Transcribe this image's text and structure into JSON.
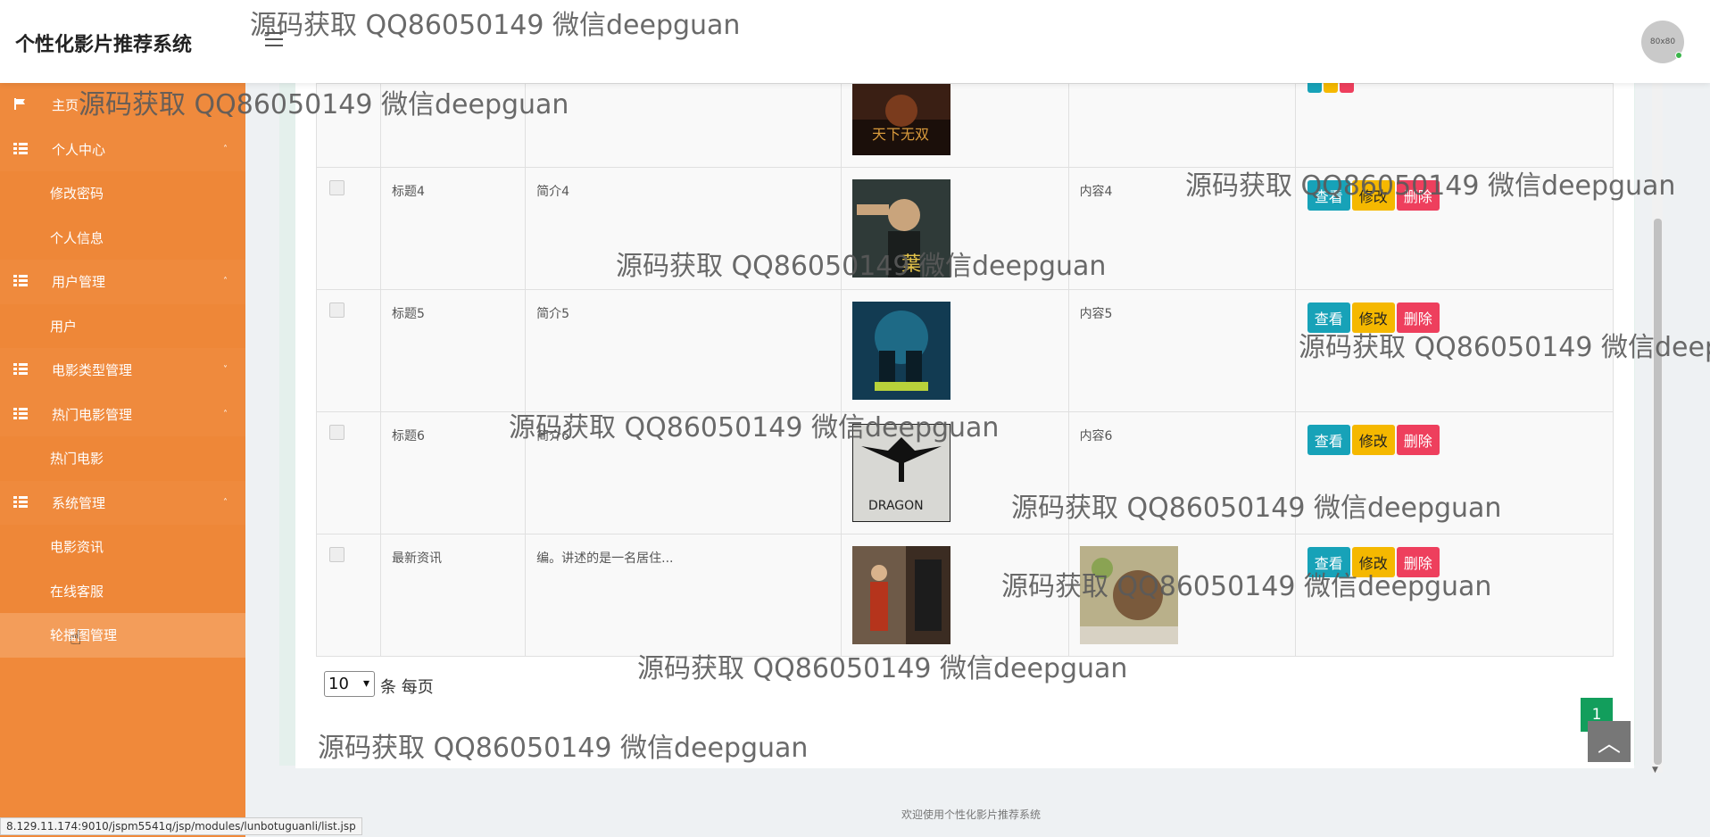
{
  "app": {
    "title": "个性化影片推荐系统",
    "avatar_text": "80x80"
  },
  "sidebar": {
    "items": [
      {
        "label": "主页",
        "type": "group",
        "icon": "flag-icon",
        "caret": ""
      },
      {
        "label": "个人中心",
        "type": "group",
        "icon": "grid-icon",
        "caret": "˄"
      },
      {
        "label": "修改密码",
        "type": "sub"
      },
      {
        "label": "个人信息",
        "type": "sub"
      },
      {
        "label": "用户管理",
        "type": "group",
        "icon": "grid-icon",
        "caret": "˄"
      },
      {
        "label": "用户",
        "type": "sub"
      },
      {
        "label": "电影类型管理",
        "type": "group",
        "icon": "grid-icon",
        "caret": "˅"
      },
      {
        "label": "热门电影管理",
        "type": "group",
        "icon": "grid-icon",
        "caret": "˄"
      },
      {
        "label": "热门电影",
        "type": "sub"
      },
      {
        "label": "系统管理",
        "type": "group",
        "icon": "grid-icon",
        "caret": "˄"
      },
      {
        "label": "电影资讯",
        "type": "sub"
      },
      {
        "label": "在线客服",
        "type": "sub"
      },
      {
        "label": "轮播图管理",
        "type": "sub",
        "hover": true
      }
    ]
  },
  "table": {
    "rows": [
      {
        "title": "",
        "intro": "",
        "content": "",
        "poster": "poster-kungfu-dark",
        "image2": ""
      },
      {
        "title": "标题4",
        "intro": "简介4",
        "content": "内容4",
        "poster": "poster-ipman"
      },
      {
        "title": "标题5",
        "intro": "简介5",
        "content": "内容5",
        "poster": "poster-blue-action"
      },
      {
        "title": "标题6",
        "intro": "简介6",
        "content": "内容6",
        "poster": "poster-dragon"
      },
      {
        "title": "最新资讯",
        "intro": "编。讲述的是一名居住...",
        "content": "",
        "poster": "poster-costume",
        "image2": "image-child-photo"
      }
    ],
    "ops": {
      "view": "查看",
      "edit": "修改",
      "delete": "删除"
    }
  },
  "pager": {
    "page_size": "10",
    "per_page_text": "条 每页",
    "current_page": "1"
  },
  "footer": {
    "text": "欢迎使用个性化影片推荐系统"
  },
  "status_url": "8.129.11.174:9010/jspm5541q/jsp/modules/lunbotuguanli/list.jsp",
  "watermark": "源码获取 QQ86050149 微信deepguan",
  "colors": {
    "sidebar": "#f0893a",
    "view": "#17a2b8",
    "edit": "#f5b800",
    "delete": "#ee3f5d",
    "page": "#129e5c"
  }
}
